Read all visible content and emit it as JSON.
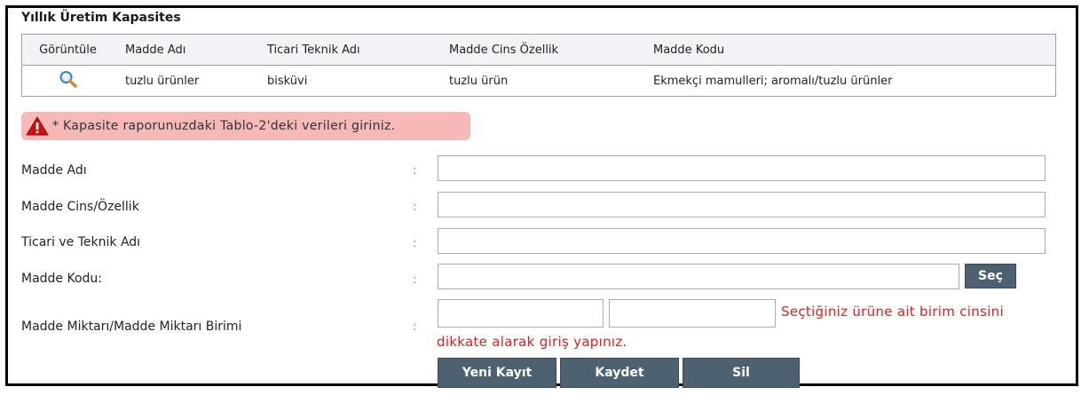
{
  "section_title": "Yıllık Üretim Kapasites",
  "table": {
    "headers": [
      "Görüntüle",
      "Madde Adı",
      "Ticari Teknik Adı",
      "Madde Cins Özellik",
      "Madde Kodu"
    ],
    "rows": [
      {
        "icon": "magnifier-icon",
        "madde_adi": "tuzlu ürünler",
        "ticari_teknik_adi": "bisküvi",
        "madde_cins_ozellik": "tuzlu ürün",
        "madde_kodu": "Ekmekçi mamulleri; aromalı/tuzlu ürünler"
      }
    ]
  },
  "alert": {
    "icon": "warning-icon",
    "color": "#f7b8b8",
    "text": "* Kapasite raporunuzdaki Tablo-2'deki verileri giriniz."
  },
  "form": {
    "colon": ":",
    "madde_adi": {
      "label": "Madde Adı",
      "value": ""
    },
    "madde_cins": {
      "label": "Madde Cins/Özellik",
      "value": ""
    },
    "ticari_teknik": {
      "label": "Ticari ve Teknik Adı",
      "value": ""
    },
    "madde_kodu": {
      "label": "Madde Kodu:",
      "value": "",
      "select_button": "Seç"
    },
    "miktar": {
      "label": "Madde Miktarı/Madde Miktarı Birimi",
      "amount": "",
      "unit": "",
      "hint_line1": "Seçtiğiniz ürüne ait birim cinsini",
      "hint_line2": "dikkate alarak giriş yapınız."
    }
  },
  "buttons": {
    "new": "Yeni Kayıt",
    "save": "Kaydet",
    "delete": "Sil"
  },
  "colors": {
    "button_bg": "#4e6170",
    "hint_text": "#e02020",
    "header_bg": "#f1f3f6"
  }
}
